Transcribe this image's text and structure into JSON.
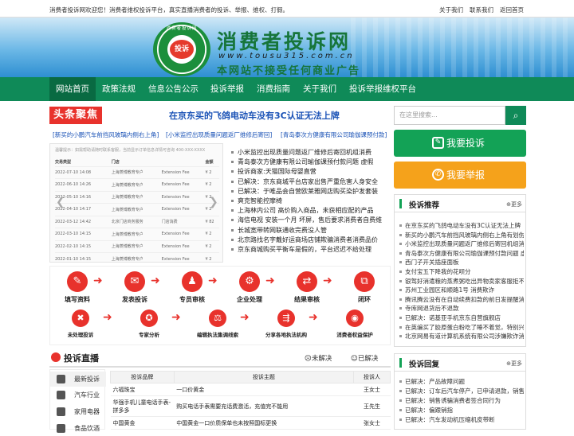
{
  "topbar": {
    "welcome": "消费者投诉网欢迎您！消费者维权投诉平台，真实直播消费者的投诉、举报、维权、打假。",
    "links": [
      "关于我们",
      "联系我们",
      "返回首页"
    ]
  },
  "banner": {
    "title": "消费者投诉网",
    "url": "www.tousu315.com.cn",
    "slogan": "本网站不接受任何商业广告",
    "logo_text": "投诉",
    "logo_ring": "消费者投诉网"
  },
  "nav": [
    "网站首页",
    "政策法规",
    "信息公告公示",
    "投诉举报",
    "消费指南",
    "关于我们",
    "投诉举报维权平台"
  ],
  "headline": {
    "badge": "头条聚焦",
    "title": "在京东买的飞鸽电动车没有3C认证无法上牌",
    "links": [
      "[新买的小鹏汽车前挡风玻璃内侧右上角]",
      "[小米监控出现质量问题返厂维修后寄回]",
      "[青岛泰次方健康有限公司瑜伽课预付款]"
    ]
  },
  "slider": {
    "header": "温馨提示：如需帮助请随时联系客服，当前显示订单信息详情可咨询 400-XXX-XXXX",
    "columns": [
      "交易类型",
      "门店",
      "",
      "金额"
    ],
    "rows": [
      [
        "2022-07-10 14:08",
        "上海菱博教育专户",
        "Extension Fee",
        "¥ 2"
      ],
      [
        "2022-06-10 14:26",
        "上海菱博教育专户",
        "Extension Fee",
        "¥ 2"
      ],
      [
        "2022-05-10 14:16",
        "上海菱博教育专户",
        "Extension Fee",
        "¥ 2"
      ],
      [
        "2022-04-10 14:17",
        "上海菱博教育专户",
        "Extension Fee",
        "¥ 2"
      ],
      [
        "2022-03-12 14:42",
        "北京门店商务服务",
        "门店消费",
        "¥ 82"
      ],
      [
        "2022-03-10 14:15",
        "上海菱博教育专户",
        "Extension Fee",
        "¥ 2"
      ],
      [
        "2022-02-10 14:15",
        "上海菱博教育专户",
        "Extension Fee",
        "¥ 2"
      ],
      [
        "2022-01-10 14:15",
        "上海菱博教育专户",
        "Extension Fee",
        "¥ 2"
      ]
    ]
  },
  "news": [
    "小米监控出现质量问题返厂维修后寄回机组消费",
    "青岛泰次方健康有限公司瑜伽课预付款问题 虚假",
    "投诉商家:天猫国际母婴直营",
    "已解决：京东商城平台店家出售严重危害人身安全",
    "已解决：于唯品会自营欧莱雅网店购买染护发套装",
    "爽克智能控摩椅",
    "上海林内公司 高价购入商品，未获相应配的产品",
    "海信电视 安装一个月 坏屏，售后要求消费者自费维",
    "长城宽带转网联通收完费没人管",
    "北京路找名字戴好运商场店铺欺骗消费者消费品价",
    "京东商城购买平衡车是假的，平台迟迟不给处理"
  ],
  "flow": {
    "row1": [
      "填写资料",
      "发表投诉",
      "专员审核",
      "企业处理",
      "结果审核",
      "闭环"
    ],
    "row2": [
      "未处理投诉",
      "专家分析",
      "编辑执法集调线索",
      "分享各地执法机构",
      "消费者权益保护"
    ]
  },
  "live": {
    "title": "投诉直播",
    "unresolved": "未解决",
    "resolved": "已解决",
    "categories": [
      "最新投诉",
      "汽车行业",
      "家用电器",
      "食品饮酒"
    ],
    "columns": [
      "投诉品牌",
      "投诉主题",
      "投诉人"
    ],
    "rows": [
      [
        "六福珠宝",
        "一口价黄金",
        "王女士"
      ],
      [
        "华强手机儿童电话手表-拼多多",
        "购买电话手表需要充话费激活，充值完不能用",
        "王先生"
      ],
      [
        "中国黄金",
        "中国黄金一口价质保单也未按照国标更换",
        "张女士"
      ]
    ]
  },
  "sidebar": {
    "search_placeholder": "在这里搜索...",
    "complain_label": "我要投诉",
    "report_label": "我要举报",
    "recommend_title": "投诉推荐",
    "more": "更多",
    "recommend": [
      "在京东买的飞鸽电动车没有3C认证无法上牌",
      "新买的小鹏汽车前挡风玻璃内侧右上角有划伤",
      "小米监控出现质量问题返厂维修后寄回机组消",
      "青岛泰次方健康有限公司瑜伽课预付款问题 虚",
      "西门子开关插座面板",
      "支付宝五下降我的花呗分",
      "银驾好消遣粮的蒸煮粥吃出异物卖家客服拒不承",
      "苏州工业园区和顺路1号 消费欺诈",
      "腾讯腾云没有在自动续费扣款的前日发提醒消费",
      "寺库网退货后不退款",
      "已解决：诺基亚手机京东自营旗舰店",
      "在英编买了胶原蛋白粉吃了睡不着觉，特别兴奋",
      "北京网易有道计算机系统有限公司涉嫌欺诈消费"
    ],
    "reply_title": "投诉回复",
    "reply": [
      "已解决：产品故障问题",
      "已解决：订车后汽车停产，已申请退款，销售及",
      "已解决：销售诱骗消费者签合同行为",
      "已解决：偏跟销指",
      "已解决：汽车发动机压缩机皮带断"
    ]
  }
}
